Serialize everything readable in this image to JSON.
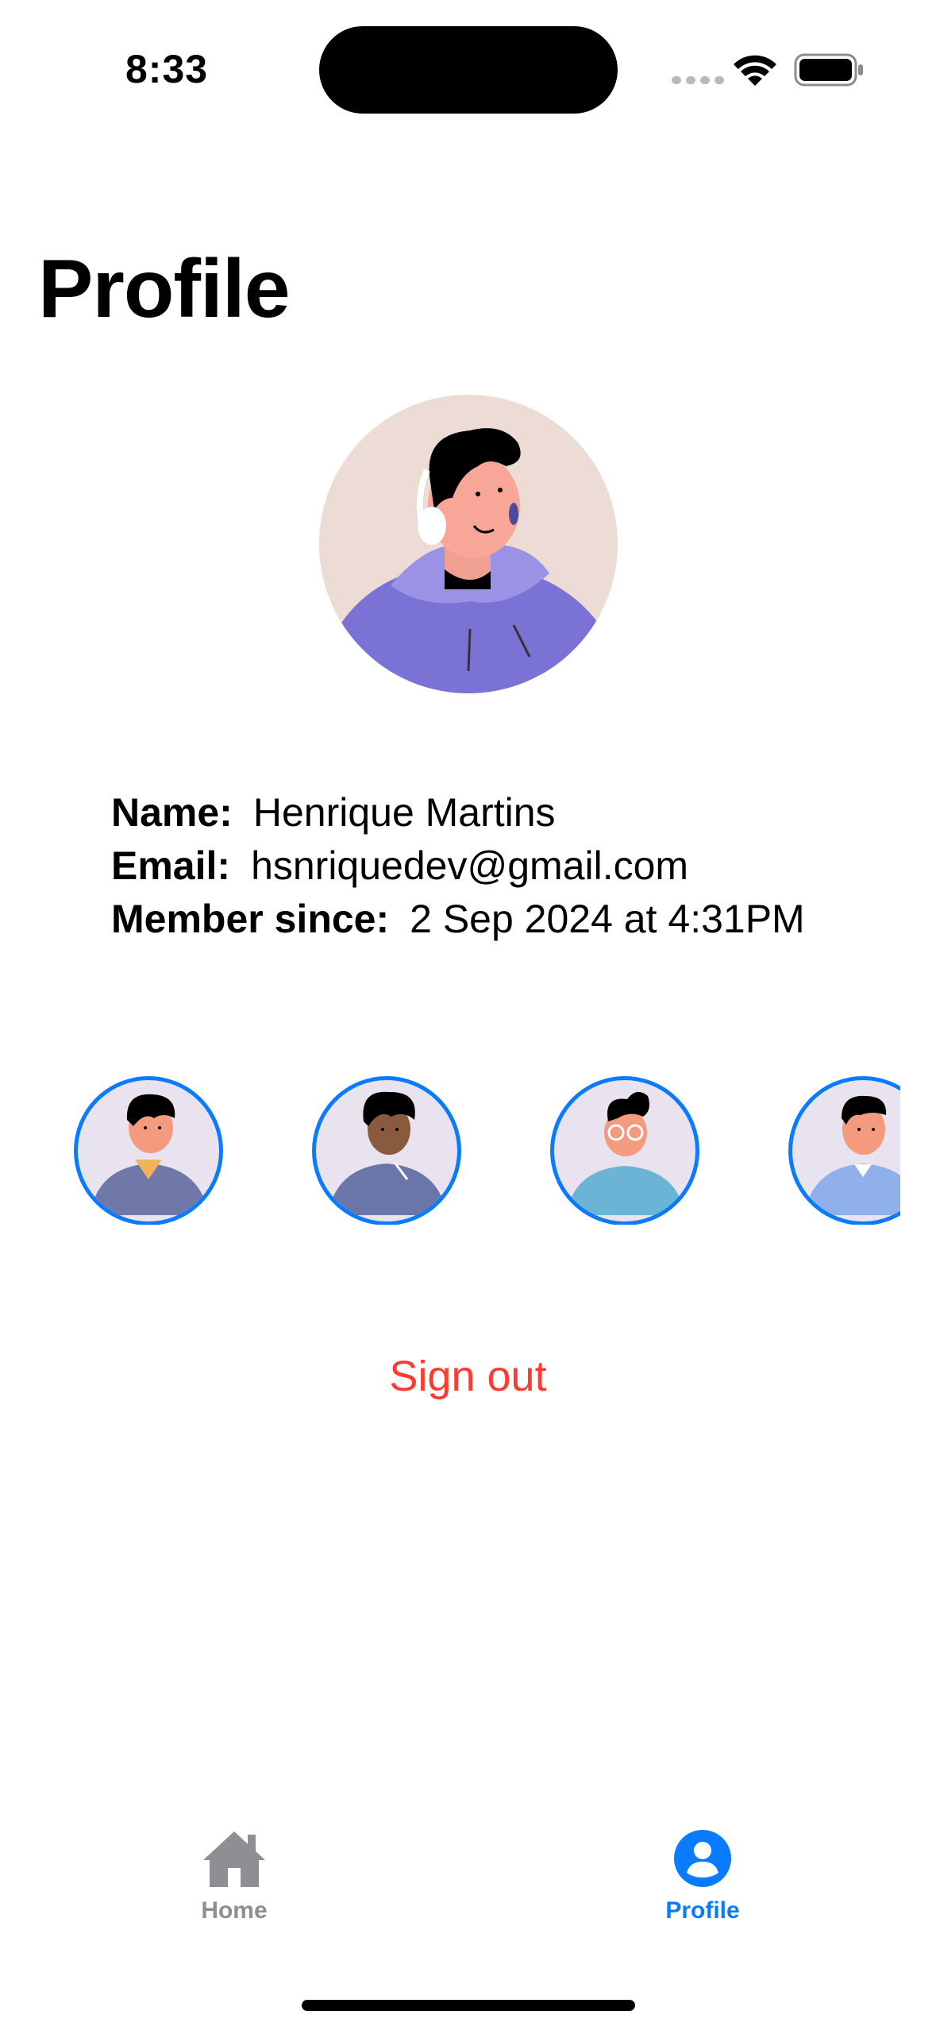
{
  "status_bar": {
    "time": "8:33",
    "icons": [
      "cellular-signal-icon",
      "wifi-icon",
      "battery-icon"
    ]
  },
  "page": {
    "title": "Profile"
  },
  "profile": {
    "avatar_icon": "profile-avatar-headphones",
    "name_label": "Name:",
    "name_value": "Henrique Martins",
    "email_label": "Email:",
    "email_value": "hsnriquedev@gmail.com",
    "member_label": "Member since:",
    "member_value": "2 Sep 2024 at 4:31PM"
  },
  "avatar_options": [
    {
      "icon": "avatar-option-1-icon"
    },
    {
      "icon": "avatar-option-2-icon"
    },
    {
      "icon": "avatar-option-3-icon"
    },
    {
      "icon": "avatar-option-4-icon"
    }
  ],
  "actions": {
    "sign_out": "Sign out"
  },
  "tab_bar": {
    "tabs": [
      {
        "label": "Home",
        "icon": "house-icon",
        "selected": false
      },
      {
        "label": "Profile",
        "icon": "person-circle-icon",
        "selected": true
      }
    ]
  },
  "colors": {
    "accent": "#0a7bff",
    "destructive": "#ff3b30",
    "inactive": "#8e8e93",
    "avatar_bg": "#ecdcd5",
    "hoodie": "#7b72d5"
  }
}
